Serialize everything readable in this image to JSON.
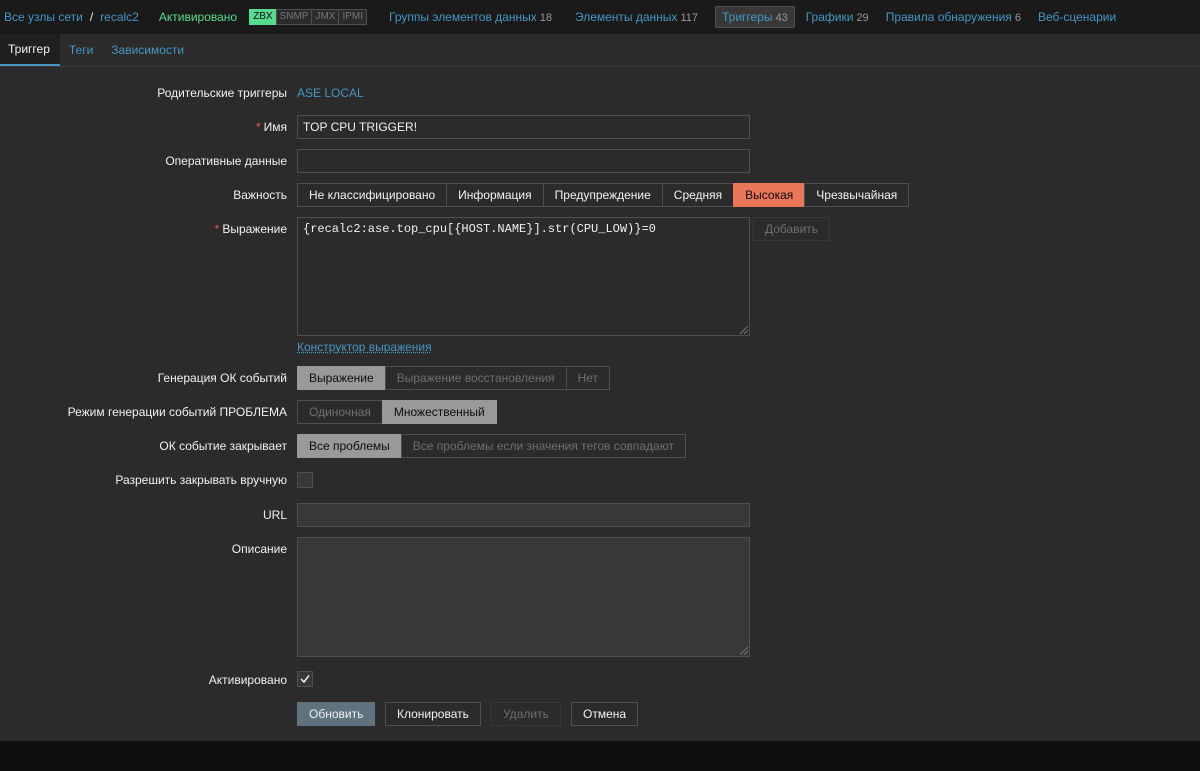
{
  "hostnav": {
    "all_hosts": "Все узлы сети",
    "separator": "/",
    "host": "recalc2",
    "status": "Активировано",
    "availability": [
      "ZBX",
      "SNMP",
      "JMX",
      "IPMI"
    ],
    "items": [
      {
        "label": "Группы элементов данных",
        "count": "18"
      },
      {
        "label": "Элементы данных",
        "count": "117"
      },
      {
        "label": "Триггеры",
        "count": "43"
      },
      {
        "label": "Графики",
        "count": "29"
      },
      {
        "label": "Правила обнаружения",
        "count": "6"
      },
      {
        "label": "Веб-сценарии",
        "count": ""
      }
    ]
  },
  "tabs": [
    "Триггер",
    "Теги",
    "Зависимости"
  ],
  "form": {
    "parent_label": "Родительские триггеры",
    "parent_value": "ASE LOCAL",
    "name_label": "Имя",
    "name_value": "TOP CPU TRIGGER!",
    "opdata_label": "Оперативные данные",
    "opdata_value": "",
    "severity_label": "Важность",
    "severity_options": [
      "Не классифицировано",
      "Информация",
      "Предупреждение",
      "Средняя",
      "Высокая",
      "Чрезвычайная"
    ],
    "severity_selected": "Высокая",
    "expression_label": "Выражение",
    "expression_value": "{recalc2:ase.top_cpu[{HOST.NAME}].str(CPU_LOW)}=0",
    "add_button": "Добавить",
    "expression_constructor": "Конструктор выражения",
    "ok_gen_label": "Генерация ОК событий",
    "ok_gen_options": [
      "Выражение",
      "Выражение восстановления",
      "Нет"
    ],
    "problem_mode_label": "Режим генерации событий ПРОБЛЕМА",
    "problem_mode_options": [
      "Одиночная",
      "Множественный"
    ],
    "ok_closes_label": "ОК событие закрывает",
    "ok_closes_options": [
      "Все проблемы",
      "Все проблемы если значения тегов совпадают"
    ],
    "manual_close_label": "Разрешить закрывать вручную",
    "url_label": "URL",
    "url_value": "",
    "description_label": "Описание",
    "description_value": "",
    "enabled_label": "Активировано"
  },
  "buttons": {
    "update": "Обновить",
    "clone": "Клонировать",
    "delete": "Удалить",
    "cancel": "Отмена"
  },
  "colors": {
    "link": "#4796c4",
    "severity_high": "#e97659",
    "status_enabled": "#59db8f",
    "required": "#e45959"
  }
}
